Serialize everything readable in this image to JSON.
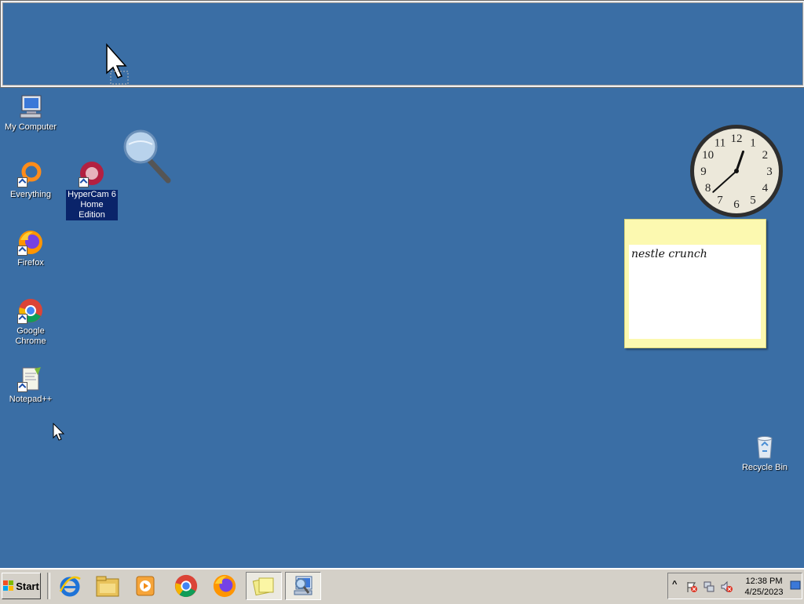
{
  "desktop": {
    "background_color": "#3a6ea5",
    "icons": [
      {
        "label": "My Computer"
      },
      {
        "label": "Everything"
      },
      {
        "label": "HyperCam 6 Home Edition"
      },
      {
        "label": "Firefox"
      },
      {
        "label": "Google Chrome"
      },
      {
        "label": "Notepad++"
      },
      {
        "label": "Recycle Bin"
      }
    ]
  },
  "sticky_note": {
    "text": "nestle crunch"
  },
  "clock": {
    "numerals": [
      "12",
      "1",
      "2",
      "3",
      "4",
      "5",
      "6",
      "7",
      "8",
      "9",
      "10",
      "11"
    ],
    "hour": 12,
    "minute": 38
  },
  "taskbar": {
    "start_label": "Start",
    "pinned": [
      "internet-explorer-icon",
      "windows-explorer-icon",
      "media-player-icon",
      "chrome-icon",
      "firefox-icon",
      "sticky-notes-icon",
      "magnifier-icon"
    ],
    "tray": {
      "time": "12:38 PM",
      "date": "4/25/2023"
    }
  }
}
